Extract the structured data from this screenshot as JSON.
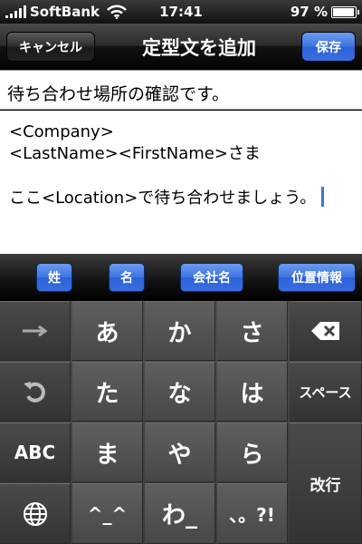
{
  "status_bar": {
    "carrier": "SoftBank",
    "time": "17:41",
    "battery_percent": "97 %",
    "battery_level": 0.97
  },
  "nav": {
    "cancel_label": "キャンセル",
    "title": "定型文を追加",
    "save_label": "保存"
  },
  "subject": {
    "value": "待ち合わせ場所の確認です。"
  },
  "body": {
    "lines": [
      "<Company>",
      "<LastName><FirstName>さま",
      "",
      "ここ<Location>で待ち合わせましょう。"
    ]
  },
  "insert_buttons": [
    "姓",
    "名",
    "会社名",
    "位置情報"
  ],
  "keyboard": {
    "row1": [
      "→",
      "あ",
      "か",
      "さ",
      "⌫"
    ],
    "row2": [
      "↺",
      "た",
      "な",
      "は",
      "スペース"
    ],
    "row3": [
      "ABC",
      "ま",
      "や",
      "ら",
      "改行"
    ],
    "row4": [
      "🌐",
      "^_^",
      "わ_",
      "、。?!"
    ]
  }
}
